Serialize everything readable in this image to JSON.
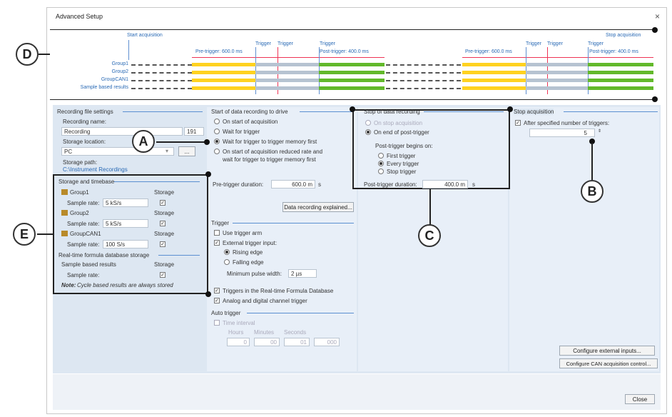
{
  "window": {
    "title": "Advanced Setup",
    "close": "×"
  },
  "timeline": {
    "start": "Start acquisition",
    "stop": "Stop acquisition",
    "trigger": "Trigger",
    "pre1": "Pre-trigger: 600.0 ms",
    "post1": "Post-trigger: 400.0 ms",
    "pre2": "Pre-trigger: 600.0 ms",
    "post2": "Post-trigger: 400.0 ms",
    "rows": [
      "Group1",
      "Group2",
      "GroupCAN1",
      "Sample based results"
    ]
  },
  "callouts": {
    "a": "A",
    "b": "B",
    "c": "C",
    "d": "D",
    "e": "E"
  },
  "recording": {
    "section": "Recording file settings",
    "name_label": "Recording name:",
    "name_value": "Recording",
    "name_count": "191",
    "storage_label": "Storage location:",
    "storage_value": "PC",
    "browse": "...",
    "path_label": "Storage path:",
    "path_value": "C:\\Instrument Recordings"
  },
  "storage": {
    "section": "Storage and timebase",
    "groups": [
      {
        "name": "Group1",
        "rate_label": "Sample rate:",
        "rate": "5 kS/s",
        "storage": "Storage"
      },
      {
        "name": "Group2",
        "rate_label": "Sample rate:",
        "rate": "5 kS/s",
        "storage": "Storage"
      },
      {
        "name": "GroupCAN1",
        "rate_label": "Sample rate:",
        "rate": "100 S/s",
        "storage": "Storage"
      }
    ],
    "rt_section": "Real-time formula database storage",
    "sbr": "Sample based results",
    "sbr_storage": "Storage",
    "sbr_rate": "Sample rate:",
    "note_b": "Note:",
    "note": "Cycle based results are always stored"
  },
  "start": {
    "section": "Start of data recording to drive",
    "opts": [
      "On start of acquisition",
      "Wait for trigger",
      "Wait for trigger to trigger memory first",
      "On start of acquisition reduced rate and",
      "wait for trigger to trigger memory first"
    ],
    "pre_label": "Pre-trigger duration:",
    "pre_value": "600.0 m",
    "pre_unit": "s",
    "explained": "Data recording explained..."
  },
  "trigger": {
    "section": "Trigger",
    "arm": "Use trigger arm",
    "ext": "External trigger input:",
    "rising": "Rising edge",
    "falling": "Falling edge",
    "minpulse": "Minimum pulse width:",
    "minpulse_value": "2 µs",
    "rtfd": "Triggers in the Real-time Formula Database",
    "analog": "Analog and digital channel trigger",
    "auto_section": "Auto trigger",
    "interval": "Time interval",
    "hours": "Hours",
    "minutes": "Minutes",
    "seconds": "Seconds",
    "h": "0",
    "m": "00",
    "s": "01",
    "ms": "000"
  },
  "stop": {
    "section": "Stop of data recording",
    "opt1": "On stop acquisition",
    "opt2": "On end of post-trigger",
    "begins": "Post-trigger begins on:",
    "b1": "First trigger",
    "b2": "Every trigger",
    "b3": "Stop trigger",
    "post_label": "Post-trigger duration:",
    "post_value": "400.0 m",
    "post_unit": "s"
  },
  "stopacq": {
    "section": "Stop acquisition",
    "after": "After specified number of triggers:",
    "count": "5",
    "ext_btn": "Configure external inputs...",
    "can_btn": "Configure CAN acquisition control..."
  },
  "close_btn": "Close"
}
